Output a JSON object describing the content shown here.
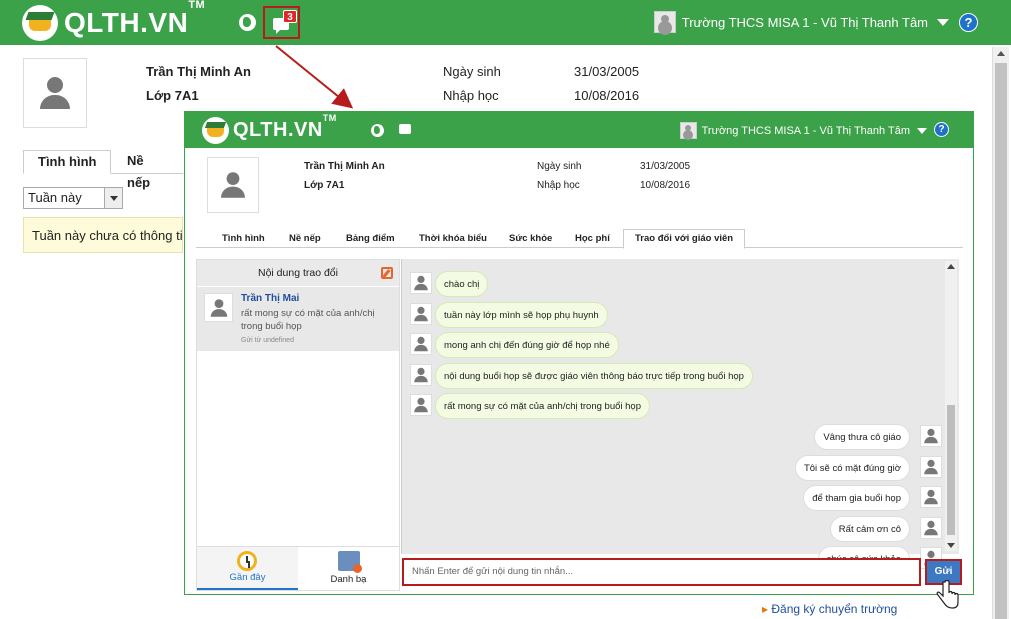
{
  "header": {
    "logo_text": "QLTH.VN",
    "logo_tm": "TM",
    "message_badge": "3",
    "user_label": "Trường THCS MISA 1 - Vũ Thị Thanh Tâm",
    "help_label": "?"
  },
  "student": {
    "name": "Trần Thị Minh An",
    "class": "Lớp 7A1",
    "dob_label": "Ngày sinh",
    "dob_value": "31/03/2005",
    "enroll_label": "Nhập học",
    "enroll_value": "10/08/2016"
  },
  "background": {
    "tabs": [
      "Tình hình",
      "Nề nếp"
    ],
    "period_select": "Tuần này",
    "notice": "Tuần này chưa có thông tin.",
    "transfer_link": "Đăng ký chuyển trường"
  },
  "zoom": {
    "tabs": [
      "Tình hình",
      "Nề nếp",
      "Bảng điểm",
      "Thời khóa biểu",
      "Sức khỏe",
      "Học phí",
      "Trao đổi với giáo viên"
    ],
    "active_tab": "Trao đổi với giáo viên",
    "sidebar_title": "Nội dung trao đổi",
    "conversation": {
      "name": "Trần Thị Mai",
      "preview": "rất mong sự có mặt của anh/chị trong buổi họp",
      "sent_from": "Gửi từ undefined"
    },
    "footer_tabs": [
      "Gần đây",
      "Danh bạ"
    ],
    "messages_in": [
      "chào chị",
      "tuần này lớp mình sẽ họp phụ huynh",
      "mong anh chị đến đúng giờ để họp nhé",
      "nội dung buổi họp sẽ được giáo viên thông báo trực tiếp trong buổi họp",
      "rất mong sự có mặt của anh/chị trong buổi họp"
    ],
    "messages_out": [
      "Vâng thưa cô giáo",
      "Tôi sẽ có mặt đúng giờ",
      "để tham gia buổi họp",
      "Rất cảm ơn cô",
      "chúc cô sức khỏe"
    ],
    "input_placeholder": "Nhấn Enter để gửi nội dung tin nhắn...",
    "send_label": "Gửi"
  },
  "colors": {
    "brand_green": "#3ca24a",
    "highlight_red": "#b71c1c",
    "send_blue": "#3d79c2"
  }
}
